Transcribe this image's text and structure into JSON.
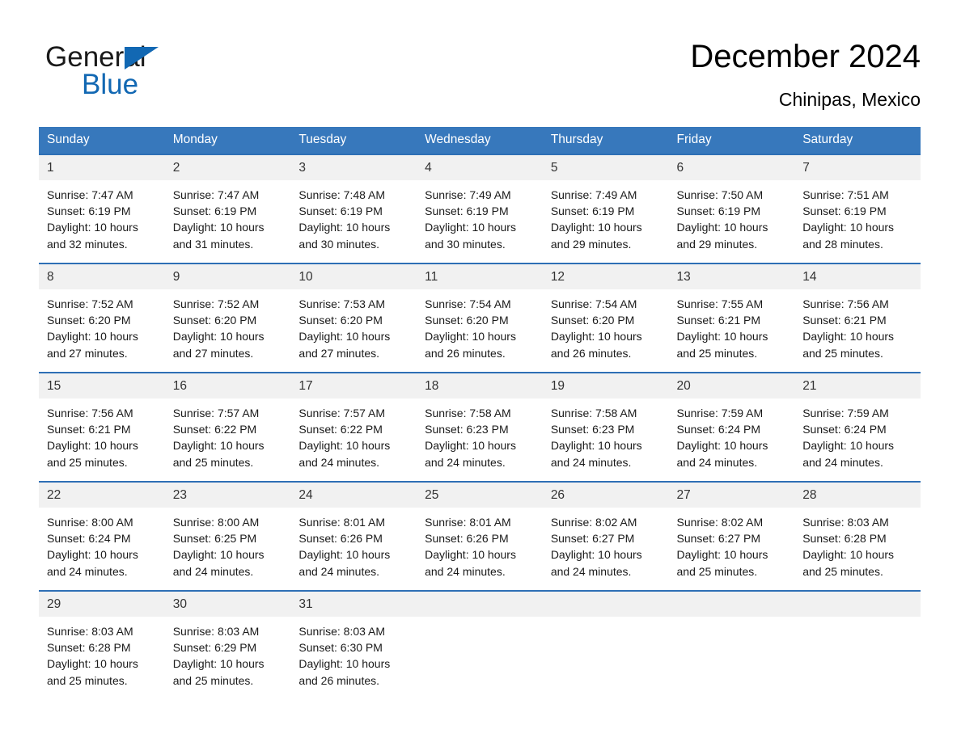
{
  "logo": {
    "word_one": "General",
    "word_two": "Blue",
    "triangle_color": "#1268b3",
    "icon": "triangle-icon"
  },
  "header": {
    "title": "December 2024",
    "location": "Chinipas, Mexico"
  },
  "calendar": {
    "header_bg": "#3778bc",
    "row_border_color": "#2e6fb5",
    "day_header_bg": "#f1f1f1",
    "weekday_headers": [
      "Sunday",
      "Monday",
      "Tuesday",
      "Wednesday",
      "Thursday",
      "Friday",
      "Saturday"
    ],
    "weeks": [
      [
        {
          "day": "1",
          "sunrise": "Sunrise: 7:47 AM",
          "sunset": "Sunset: 6:19 PM",
          "daylight_line1": "Daylight: 10 hours",
          "daylight_line2": "and 32 minutes."
        },
        {
          "day": "2",
          "sunrise": "Sunrise: 7:47 AM",
          "sunset": "Sunset: 6:19 PM",
          "daylight_line1": "Daylight: 10 hours",
          "daylight_line2": "and 31 minutes."
        },
        {
          "day": "3",
          "sunrise": "Sunrise: 7:48 AM",
          "sunset": "Sunset: 6:19 PM",
          "daylight_line1": "Daylight: 10 hours",
          "daylight_line2": "and 30 minutes."
        },
        {
          "day": "4",
          "sunrise": "Sunrise: 7:49 AM",
          "sunset": "Sunset: 6:19 PM",
          "daylight_line1": "Daylight: 10 hours",
          "daylight_line2": "and 30 minutes."
        },
        {
          "day": "5",
          "sunrise": "Sunrise: 7:49 AM",
          "sunset": "Sunset: 6:19 PM",
          "daylight_line1": "Daylight: 10 hours",
          "daylight_line2": "and 29 minutes."
        },
        {
          "day": "6",
          "sunrise": "Sunrise: 7:50 AM",
          "sunset": "Sunset: 6:19 PM",
          "daylight_line1": "Daylight: 10 hours",
          "daylight_line2": "and 29 minutes."
        },
        {
          "day": "7",
          "sunrise": "Sunrise: 7:51 AM",
          "sunset": "Sunset: 6:19 PM",
          "daylight_line1": "Daylight: 10 hours",
          "daylight_line2": "and 28 minutes."
        }
      ],
      [
        {
          "day": "8",
          "sunrise": "Sunrise: 7:52 AM",
          "sunset": "Sunset: 6:20 PM",
          "daylight_line1": "Daylight: 10 hours",
          "daylight_line2": "and 27 minutes."
        },
        {
          "day": "9",
          "sunrise": "Sunrise: 7:52 AM",
          "sunset": "Sunset: 6:20 PM",
          "daylight_line1": "Daylight: 10 hours",
          "daylight_line2": "and 27 minutes."
        },
        {
          "day": "10",
          "sunrise": "Sunrise: 7:53 AM",
          "sunset": "Sunset: 6:20 PM",
          "daylight_line1": "Daylight: 10 hours",
          "daylight_line2": "and 27 minutes."
        },
        {
          "day": "11",
          "sunrise": "Sunrise: 7:54 AM",
          "sunset": "Sunset: 6:20 PM",
          "daylight_line1": "Daylight: 10 hours",
          "daylight_line2": "and 26 minutes."
        },
        {
          "day": "12",
          "sunrise": "Sunrise: 7:54 AM",
          "sunset": "Sunset: 6:20 PM",
          "daylight_line1": "Daylight: 10 hours",
          "daylight_line2": "and 26 minutes."
        },
        {
          "day": "13",
          "sunrise": "Sunrise: 7:55 AM",
          "sunset": "Sunset: 6:21 PM",
          "daylight_line1": "Daylight: 10 hours",
          "daylight_line2": "and 25 minutes."
        },
        {
          "day": "14",
          "sunrise": "Sunrise: 7:56 AM",
          "sunset": "Sunset: 6:21 PM",
          "daylight_line1": "Daylight: 10 hours",
          "daylight_line2": "and 25 minutes."
        }
      ],
      [
        {
          "day": "15",
          "sunrise": "Sunrise: 7:56 AM",
          "sunset": "Sunset: 6:21 PM",
          "daylight_line1": "Daylight: 10 hours",
          "daylight_line2": "and 25 minutes."
        },
        {
          "day": "16",
          "sunrise": "Sunrise: 7:57 AM",
          "sunset": "Sunset: 6:22 PM",
          "daylight_line1": "Daylight: 10 hours",
          "daylight_line2": "and 25 minutes."
        },
        {
          "day": "17",
          "sunrise": "Sunrise: 7:57 AM",
          "sunset": "Sunset: 6:22 PM",
          "daylight_line1": "Daylight: 10 hours",
          "daylight_line2": "and 24 minutes."
        },
        {
          "day": "18",
          "sunrise": "Sunrise: 7:58 AM",
          "sunset": "Sunset: 6:23 PM",
          "daylight_line1": "Daylight: 10 hours",
          "daylight_line2": "and 24 minutes."
        },
        {
          "day": "19",
          "sunrise": "Sunrise: 7:58 AM",
          "sunset": "Sunset: 6:23 PM",
          "daylight_line1": "Daylight: 10 hours",
          "daylight_line2": "and 24 minutes."
        },
        {
          "day": "20",
          "sunrise": "Sunrise: 7:59 AM",
          "sunset": "Sunset: 6:24 PM",
          "daylight_line1": "Daylight: 10 hours",
          "daylight_line2": "and 24 minutes."
        },
        {
          "day": "21",
          "sunrise": "Sunrise: 7:59 AM",
          "sunset": "Sunset: 6:24 PM",
          "daylight_line1": "Daylight: 10 hours",
          "daylight_line2": "and 24 minutes."
        }
      ],
      [
        {
          "day": "22",
          "sunrise": "Sunrise: 8:00 AM",
          "sunset": "Sunset: 6:24 PM",
          "daylight_line1": "Daylight: 10 hours",
          "daylight_line2": "and 24 minutes."
        },
        {
          "day": "23",
          "sunrise": "Sunrise: 8:00 AM",
          "sunset": "Sunset: 6:25 PM",
          "daylight_line1": "Daylight: 10 hours",
          "daylight_line2": "and 24 minutes."
        },
        {
          "day": "24",
          "sunrise": "Sunrise: 8:01 AM",
          "sunset": "Sunset: 6:26 PM",
          "daylight_line1": "Daylight: 10 hours",
          "daylight_line2": "and 24 minutes."
        },
        {
          "day": "25",
          "sunrise": "Sunrise: 8:01 AM",
          "sunset": "Sunset: 6:26 PM",
          "daylight_line1": "Daylight: 10 hours",
          "daylight_line2": "and 24 minutes."
        },
        {
          "day": "26",
          "sunrise": "Sunrise: 8:02 AM",
          "sunset": "Sunset: 6:27 PM",
          "daylight_line1": "Daylight: 10 hours",
          "daylight_line2": "and 24 minutes."
        },
        {
          "day": "27",
          "sunrise": "Sunrise: 8:02 AM",
          "sunset": "Sunset: 6:27 PM",
          "daylight_line1": "Daylight: 10 hours",
          "daylight_line2": "and 25 minutes."
        },
        {
          "day": "28",
          "sunrise": "Sunrise: 8:03 AM",
          "sunset": "Sunset: 6:28 PM",
          "daylight_line1": "Daylight: 10 hours",
          "daylight_line2": "and 25 minutes."
        }
      ],
      [
        {
          "day": "29",
          "sunrise": "Sunrise: 8:03 AM",
          "sunset": "Sunset: 6:28 PM",
          "daylight_line1": "Daylight: 10 hours",
          "daylight_line2": "and 25 minutes."
        },
        {
          "day": "30",
          "sunrise": "Sunrise: 8:03 AM",
          "sunset": "Sunset: 6:29 PM",
          "daylight_line1": "Daylight: 10 hours",
          "daylight_line2": "and 25 minutes."
        },
        {
          "day": "31",
          "sunrise": "Sunrise: 8:03 AM",
          "sunset": "Sunset: 6:30 PM",
          "daylight_line1": "Daylight: 10 hours",
          "daylight_line2": "and 26 minutes."
        },
        {
          "day": "",
          "sunrise": "",
          "sunset": "",
          "daylight_line1": "",
          "daylight_line2": ""
        },
        {
          "day": "",
          "sunrise": "",
          "sunset": "",
          "daylight_line1": "",
          "daylight_line2": ""
        },
        {
          "day": "",
          "sunrise": "",
          "sunset": "",
          "daylight_line1": "",
          "daylight_line2": ""
        },
        {
          "day": "",
          "sunrise": "",
          "sunset": "",
          "daylight_line1": "",
          "daylight_line2": ""
        }
      ]
    ]
  }
}
